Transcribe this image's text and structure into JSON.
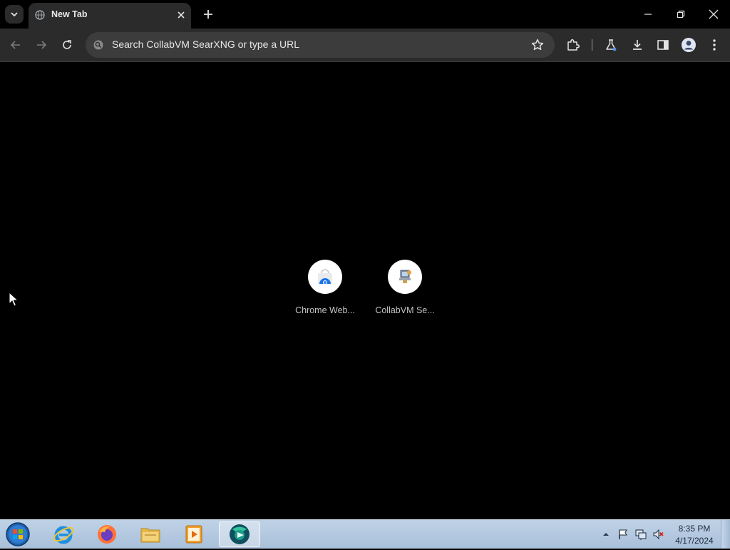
{
  "browser": {
    "tab": {
      "title": "New Tab"
    },
    "omnibox": {
      "placeholder": "Search CollabVM SearXNG or type a URL"
    }
  },
  "shortcuts": [
    {
      "label": "Chrome Web...",
      "icon": "chrome-web-store-icon"
    },
    {
      "label": "CollabVM Se...",
      "icon": "collabvm-search-icon"
    }
  ],
  "taskbar": {
    "apps": [
      "internet-explorer-icon",
      "firefox-icon",
      "file-explorer-icon",
      "media-player-icon",
      "chrome-icon"
    ],
    "clock": {
      "time": "8:35 PM",
      "date": "4/17/2024"
    }
  },
  "colors": {
    "tab_bg": "#2b2b2b",
    "toolbar_bg": "#2b2b2b",
    "omnibox_bg": "#3c3c3c",
    "content_bg": "#000000",
    "taskbar_bg": "#b4c8de"
  }
}
